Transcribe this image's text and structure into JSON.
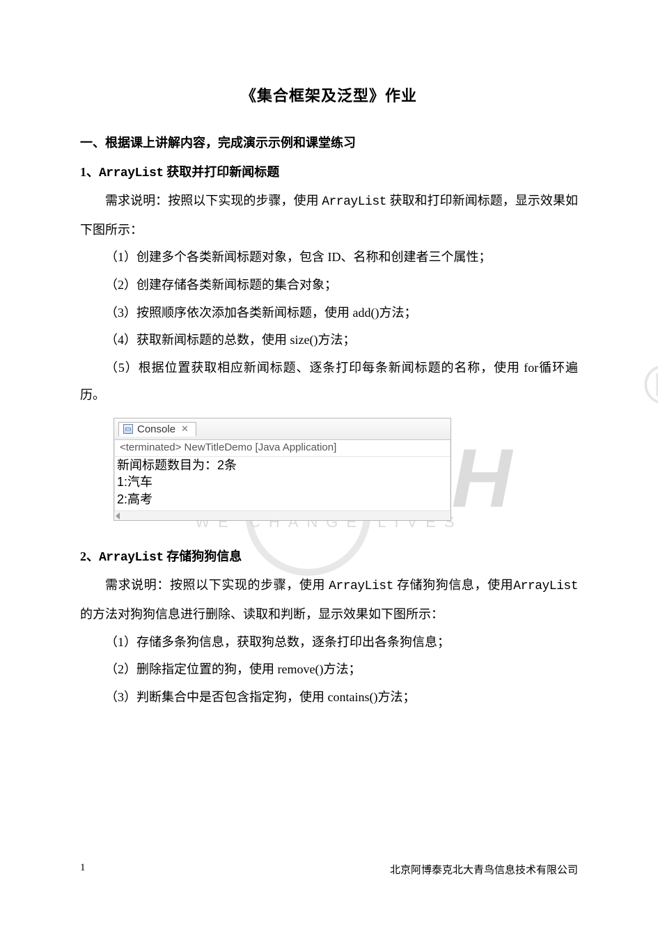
{
  "title": "《集合框架及泛型》作业",
  "section1_heading": "一、根据课上讲解内容，完成演示示例和课堂练习",
  "q1": {
    "heading_prefix": "1、",
    "heading_code": "ArrayList",
    "heading_suffix": " 获取并打印新闻标题",
    "desc_a": "需求说明：按照以下实现的步骤，使用 ",
    "desc_code": "ArrayList",
    "desc_b": " 获取和打印新闻标题，显示效果如下图所示：",
    "steps": [
      "（1）创建多个各类新闻标题对象，包含 ID、名称和创建者三个属性；",
      "（2）创建存储各类新闻标题的集合对象；",
      "（3）按照顺序依次添加各类新闻标题，使用 add()方法；",
      "（4）获取新闻标题的总数，使用 size()方法；",
      "（5）根据位置获取相应新闻标题、逐条打印每条新闻标题的名称，使用 for循环遍历。"
    ]
  },
  "console": {
    "tab_label": "Console",
    "close_x": "✕",
    "status": "<terminated> NewTitleDemo [Java Application]",
    "lines": [
      "新闻标题数目为：2条",
      "1:汽车",
      "2:高考"
    ]
  },
  "q2": {
    "heading_prefix": "2、",
    "heading_code": "ArrayList",
    "heading_suffix": " 存储狗狗信息",
    "desc_a": "需求说明：按照以下实现的步骤，使用 ",
    "desc_code1": "ArrayList",
    "desc_b": " 存储狗狗信息，使用",
    "desc_code2": "ArrayList",
    "desc_c": " 的方法对狗狗信息进行删除、读取和判断，显示效果如下图所示：",
    "steps": [
      "（1）存储多条狗信息，获取狗总数，逐条打印出各条狗信息；",
      "（2）删除指定位置的狗，使用 remove()方法；",
      "（3）判断集合中是否包含指定狗，使用 contains()方法；"
    ]
  },
  "watermark": {
    "main": "APTECH",
    "sub": "WE  CHANGE  LIVES",
    "reg": "®"
  },
  "footer": {
    "page": "1",
    "company": "北京阿博泰克北大青鸟信息技术有限公司"
  }
}
